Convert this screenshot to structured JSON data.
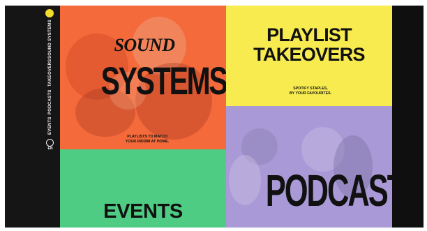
{
  "sidebar": {
    "nav": [
      {
        "label": "SOUND SYSTEMS"
      },
      {
        "label": "TAKEOVERS"
      },
      {
        "label": "PODCASTS"
      },
      {
        "label": "EVENTS"
      }
    ],
    "language": "EN",
    "icons": [
      "logo-dot-icon",
      "globe-icon"
    ]
  },
  "tiles": {
    "sound_systems": {
      "top": "SOUND",
      "main": "SYSTEMS",
      "caption_line1": "PLAYLISTS TO MATCH",
      "caption_line2": "YOUR RIDDIM AT HOME."
    },
    "playlist_takeovers": {
      "line1": "PLAYLIST",
      "line2": "TAKEOVERS",
      "caption_line1": "SPOTIFY STAPLES,",
      "caption_line2": "BY YOUR FAVOURITES."
    },
    "podcasts": {
      "title": "PODCASTS"
    },
    "events": {
      "title": "EVENTS"
    }
  },
  "colors": {
    "sound_tile": "#f46a3a",
    "playlist_tile": "#f7eb50",
    "podcasts_tile": "#a999d6",
    "events_tile": "#4fcc84",
    "sidebar": "#151515",
    "accent": "#f3dc2e"
  }
}
